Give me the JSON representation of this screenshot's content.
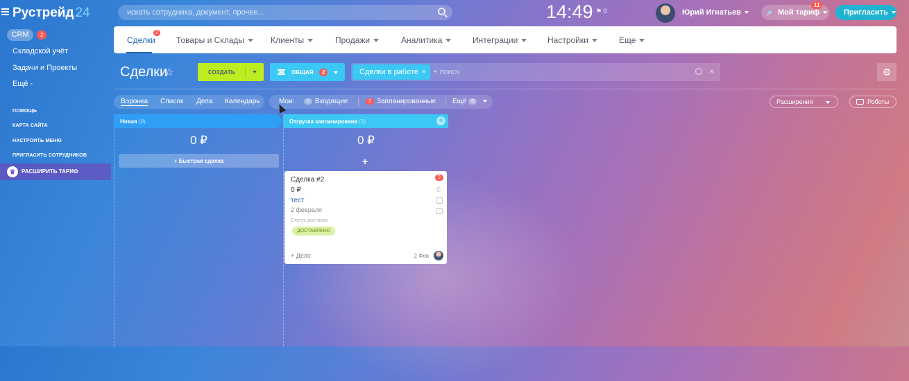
{
  "header": {
    "logo": "Рустрейд",
    "logo_suffix": "24",
    "search_placeholder": "искать сотрудника, документ, прочее...",
    "clock": "14:49",
    "flag_count": "0",
    "user_name": "Юрий Игнатьев",
    "tariff_label": "Мой тариф",
    "tariff_badge": "11",
    "invite_label": "Пригласить"
  },
  "sidebar": {
    "crm_label": "CRM",
    "crm_badge": "2",
    "items": [
      "Складской учёт",
      "Задачи и Проекты",
      "Ещё -"
    ],
    "small_items": [
      "ПОМОЩЬ",
      "КАРТА САЙТА",
      "НАСТРОИТЬ МЕНЮ",
      "ПРИГЛАСИТЬ СОТРУДНИКОВ"
    ],
    "expand_label": "РАСШИРИТЬ ТАРИФ"
  },
  "menu": {
    "items": [
      "Сделки",
      "Товары и Склады",
      "Клиенты",
      "Продажи",
      "Аналитика",
      "Интеграции",
      "Настройки",
      "Еще"
    ],
    "active_badge": "2"
  },
  "toolbar": {
    "title": "Сделки",
    "create_label": "СОЗДАТЬ",
    "filter_label": "ОБЩАЯ",
    "filter_badge": "2",
    "chip_label": "Сделки в работе",
    "search_placeholder": "+ поиск"
  },
  "views": [
    "Воронка",
    "Список",
    "Дела",
    "Календарь"
  ],
  "counters": {
    "mine_label": "Мои:",
    "incoming_count": "0",
    "incoming_label": "Входящие",
    "planned_count": "2",
    "planned_label": "Запланированные",
    "more_label": "Ещё",
    "more_count": "0"
  },
  "right_buttons": {
    "extensions_label": "Расширения",
    "robots_label": "Роботы"
  },
  "columns": [
    {
      "title": "Новая",
      "count": "(0)",
      "sum": "0 ₽",
      "quick_label": "Быстрая сделка"
    },
    {
      "title": "Отгрузка запланирована",
      "count": "(1)",
      "sum": "0 ₽"
    }
  ],
  "card": {
    "name": "Сделка #2",
    "sum": "0 ₽",
    "client": "тест",
    "date": "2 февраля",
    "field_label": "Статус доставки",
    "status": "ДОСТАВЛЕНО",
    "badge": "2",
    "add_label": "+ Дело",
    "short_date": "2 Фев"
  },
  "colors": {
    "accent_green": "#bbed21",
    "accent_blue": "#3bc8f5",
    "badge_red": "#ff5752"
  }
}
